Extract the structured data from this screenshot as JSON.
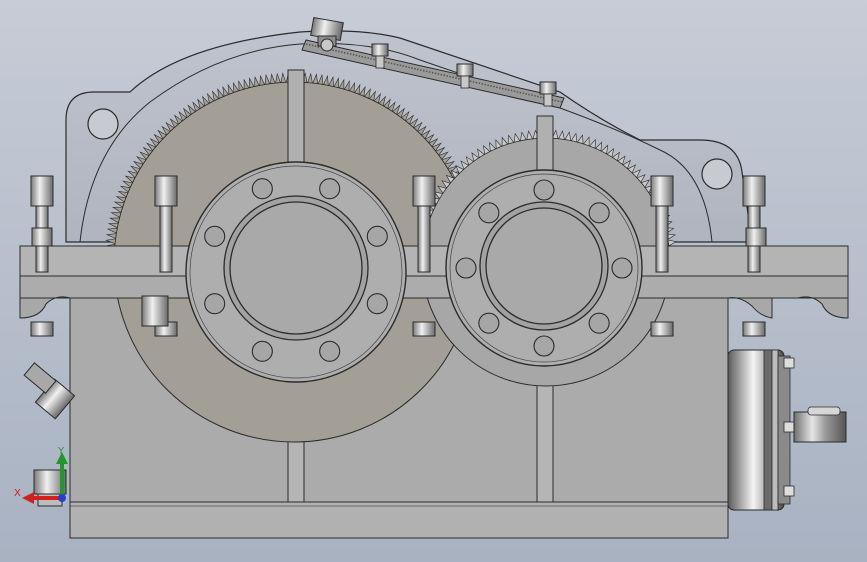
{
  "viewport": {
    "background_top": "#c7ccd6",
    "background_bottom": "#a9b2c2"
  },
  "model": {
    "type": "double-stage gear reducer housing assembly",
    "housing_color": "#a9a9a9",
    "gear_color": "#a39e96",
    "edge_color": "#2b2b2b"
  },
  "triad": {
    "x_label": "X",
    "y_label": "Y",
    "x_color": "#d41f1f",
    "y_color": "#1f9a2a",
    "z_color": "#1f3fd4"
  }
}
